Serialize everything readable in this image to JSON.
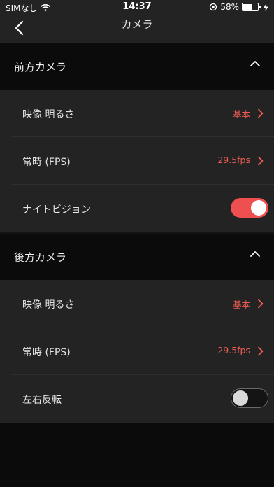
{
  "status_bar": {
    "carrier": "SIMなし",
    "time": "14:37",
    "battery_percent": "58%",
    "battery_level": 0.58
  },
  "nav": {
    "title": "カメラ"
  },
  "front_camera": {
    "title": "前方カメラ",
    "brightness_label": "映像 明るさ",
    "brightness_value": "基本",
    "fps_label": "常時 (FPS)",
    "fps_value": "29.5fps",
    "night_vision_label": "ナイトビジョン",
    "night_vision_on": true
  },
  "rear_camera": {
    "title": "後方カメラ",
    "brightness_label": "映像 明るさ",
    "brightness_value": "基本",
    "fps_label": "常時 (FPS)",
    "fps_value": "29.5fps",
    "flip_label": "左右反転",
    "flip_on": false
  },
  "colors": {
    "accent": "#ee5c52",
    "toggle_on": "#ef4f4f",
    "row_bg": "#232323",
    "header_bg": "#0b0b0b"
  }
}
